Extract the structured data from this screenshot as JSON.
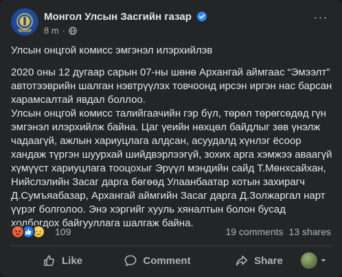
{
  "post": {
    "page_name": "Монгол Улсын Засгийн газар",
    "time": "8 m",
    "meta_separator": "·",
    "more_label": "···",
    "title_line": "Улсын онцгой комисс эмгэнэл илэрхийлэв",
    "paragraphs": [
      "2020 оны 12 дугаар сарын 07-ны шөнө Архангай аймгаас “Эмээлт” автотээврийн шалган нэвтрүүлэх товчоонд ирсэн иргэн нас барсан харамсалтай явдал боллоо.",
      "Улсын онцгой комисс талийгаачийн гэр бүл, төрөл төрөгсөдөд гүн эмгэнэл илэрхийлж байна. Цаг үеийн нөхцөл байдлыг зөв үнэлж чадаагүй, ажлын хариуцлага алдсан, асуудалд хүнлэг ёсоор хандаж түргэн шуурхай шийдвэрлээгүй, зохих арга хэмжээ аваагүй хүмүүст хариуцлага тооцохыг Эрүүл мэндийн сайд Т.Мөнхсайхан, Нийслэлийн Засаг дарга бөгөөд Улаанбаатар хотын захирагч Д.Сумъяабазар, Архангай аймгийн Засаг дарга Д.Золжаргал нарт үүрэг болголоо. Энэ хэргийг хууль хяналтын болон бусад холбогдох байгууллага шалгаж байна."
    ],
    "reaction_count": "109",
    "comments": "19 comments",
    "shares": "13 shares",
    "actions": {
      "like": "Like",
      "comment": "Comment",
      "share": "Share"
    }
  },
  "colors": {
    "card": "#242526",
    "text": "#e4e6eb",
    "secondary": "#b0b3b8",
    "verified": "#2d88ff"
  },
  "icons": [
    "government-emblem-avatar",
    "verified-badge-icon",
    "globe-icon",
    "more-icon",
    "angry-reaction-icon",
    "like-reaction-icon",
    "sad-reaction-icon",
    "like-icon",
    "comment-icon",
    "share-icon",
    "profile-avatar",
    "caret-down-icon"
  ]
}
